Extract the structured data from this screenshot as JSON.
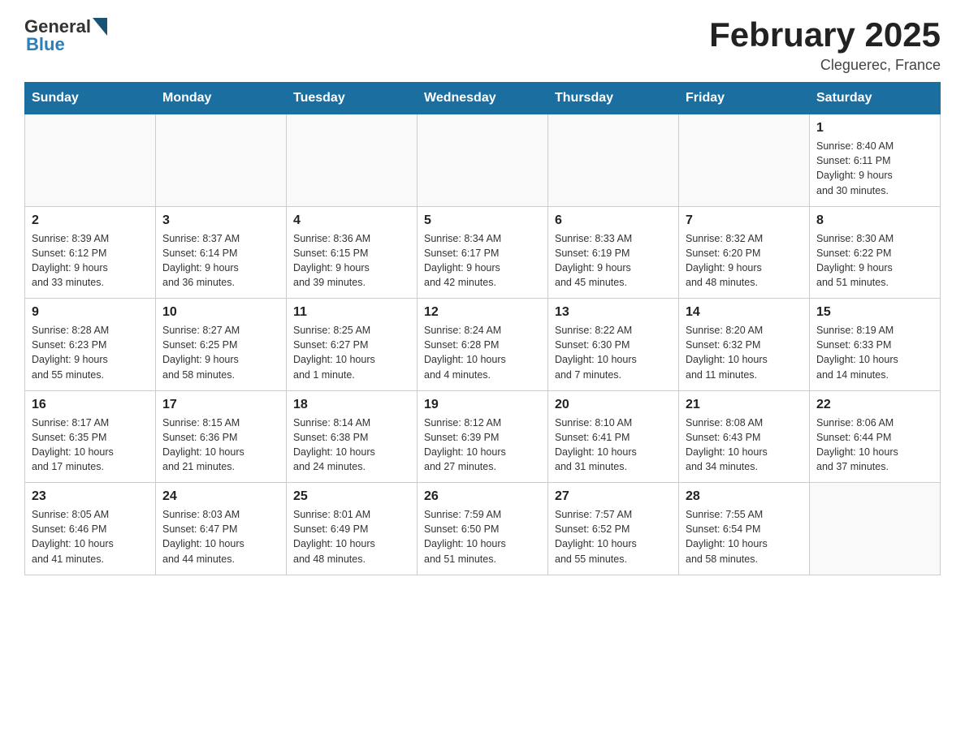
{
  "header": {
    "logo": {
      "general": "General",
      "blue": "Blue",
      "triangle_color": "#1a5276"
    },
    "title": "February 2025",
    "location": "Cleguerec, France"
  },
  "calendar": {
    "days_of_week": [
      "Sunday",
      "Monday",
      "Tuesday",
      "Wednesday",
      "Thursday",
      "Friday",
      "Saturday"
    ],
    "weeks": [
      [
        {
          "day": "",
          "info": ""
        },
        {
          "day": "",
          "info": ""
        },
        {
          "day": "",
          "info": ""
        },
        {
          "day": "",
          "info": ""
        },
        {
          "day": "",
          "info": ""
        },
        {
          "day": "",
          "info": ""
        },
        {
          "day": "1",
          "info": "Sunrise: 8:40 AM\nSunset: 6:11 PM\nDaylight: 9 hours\nand 30 minutes."
        }
      ],
      [
        {
          "day": "2",
          "info": "Sunrise: 8:39 AM\nSunset: 6:12 PM\nDaylight: 9 hours\nand 33 minutes."
        },
        {
          "day": "3",
          "info": "Sunrise: 8:37 AM\nSunset: 6:14 PM\nDaylight: 9 hours\nand 36 minutes."
        },
        {
          "day": "4",
          "info": "Sunrise: 8:36 AM\nSunset: 6:15 PM\nDaylight: 9 hours\nand 39 minutes."
        },
        {
          "day": "5",
          "info": "Sunrise: 8:34 AM\nSunset: 6:17 PM\nDaylight: 9 hours\nand 42 minutes."
        },
        {
          "day": "6",
          "info": "Sunrise: 8:33 AM\nSunset: 6:19 PM\nDaylight: 9 hours\nand 45 minutes."
        },
        {
          "day": "7",
          "info": "Sunrise: 8:32 AM\nSunset: 6:20 PM\nDaylight: 9 hours\nand 48 minutes."
        },
        {
          "day": "8",
          "info": "Sunrise: 8:30 AM\nSunset: 6:22 PM\nDaylight: 9 hours\nand 51 minutes."
        }
      ],
      [
        {
          "day": "9",
          "info": "Sunrise: 8:28 AM\nSunset: 6:23 PM\nDaylight: 9 hours\nand 55 minutes."
        },
        {
          "day": "10",
          "info": "Sunrise: 8:27 AM\nSunset: 6:25 PM\nDaylight: 9 hours\nand 58 minutes."
        },
        {
          "day": "11",
          "info": "Sunrise: 8:25 AM\nSunset: 6:27 PM\nDaylight: 10 hours\nand 1 minute."
        },
        {
          "day": "12",
          "info": "Sunrise: 8:24 AM\nSunset: 6:28 PM\nDaylight: 10 hours\nand 4 minutes."
        },
        {
          "day": "13",
          "info": "Sunrise: 8:22 AM\nSunset: 6:30 PM\nDaylight: 10 hours\nand 7 minutes."
        },
        {
          "day": "14",
          "info": "Sunrise: 8:20 AM\nSunset: 6:32 PM\nDaylight: 10 hours\nand 11 minutes."
        },
        {
          "day": "15",
          "info": "Sunrise: 8:19 AM\nSunset: 6:33 PM\nDaylight: 10 hours\nand 14 minutes."
        }
      ],
      [
        {
          "day": "16",
          "info": "Sunrise: 8:17 AM\nSunset: 6:35 PM\nDaylight: 10 hours\nand 17 minutes."
        },
        {
          "day": "17",
          "info": "Sunrise: 8:15 AM\nSunset: 6:36 PM\nDaylight: 10 hours\nand 21 minutes."
        },
        {
          "day": "18",
          "info": "Sunrise: 8:14 AM\nSunset: 6:38 PM\nDaylight: 10 hours\nand 24 minutes."
        },
        {
          "day": "19",
          "info": "Sunrise: 8:12 AM\nSunset: 6:39 PM\nDaylight: 10 hours\nand 27 minutes."
        },
        {
          "day": "20",
          "info": "Sunrise: 8:10 AM\nSunset: 6:41 PM\nDaylight: 10 hours\nand 31 minutes."
        },
        {
          "day": "21",
          "info": "Sunrise: 8:08 AM\nSunset: 6:43 PM\nDaylight: 10 hours\nand 34 minutes."
        },
        {
          "day": "22",
          "info": "Sunrise: 8:06 AM\nSunset: 6:44 PM\nDaylight: 10 hours\nand 37 minutes."
        }
      ],
      [
        {
          "day": "23",
          "info": "Sunrise: 8:05 AM\nSunset: 6:46 PM\nDaylight: 10 hours\nand 41 minutes."
        },
        {
          "day": "24",
          "info": "Sunrise: 8:03 AM\nSunset: 6:47 PM\nDaylight: 10 hours\nand 44 minutes."
        },
        {
          "day": "25",
          "info": "Sunrise: 8:01 AM\nSunset: 6:49 PM\nDaylight: 10 hours\nand 48 minutes."
        },
        {
          "day": "26",
          "info": "Sunrise: 7:59 AM\nSunset: 6:50 PM\nDaylight: 10 hours\nand 51 minutes."
        },
        {
          "day": "27",
          "info": "Sunrise: 7:57 AM\nSunset: 6:52 PM\nDaylight: 10 hours\nand 55 minutes."
        },
        {
          "day": "28",
          "info": "Sunrise: 7:55 AM\nSunset: 6:54 PM\nDaylight: 10 hours\nand 58 minutes."
        },
        {
          "day": "",
          "info": ""
        }
      ]
    ]
  }
}
